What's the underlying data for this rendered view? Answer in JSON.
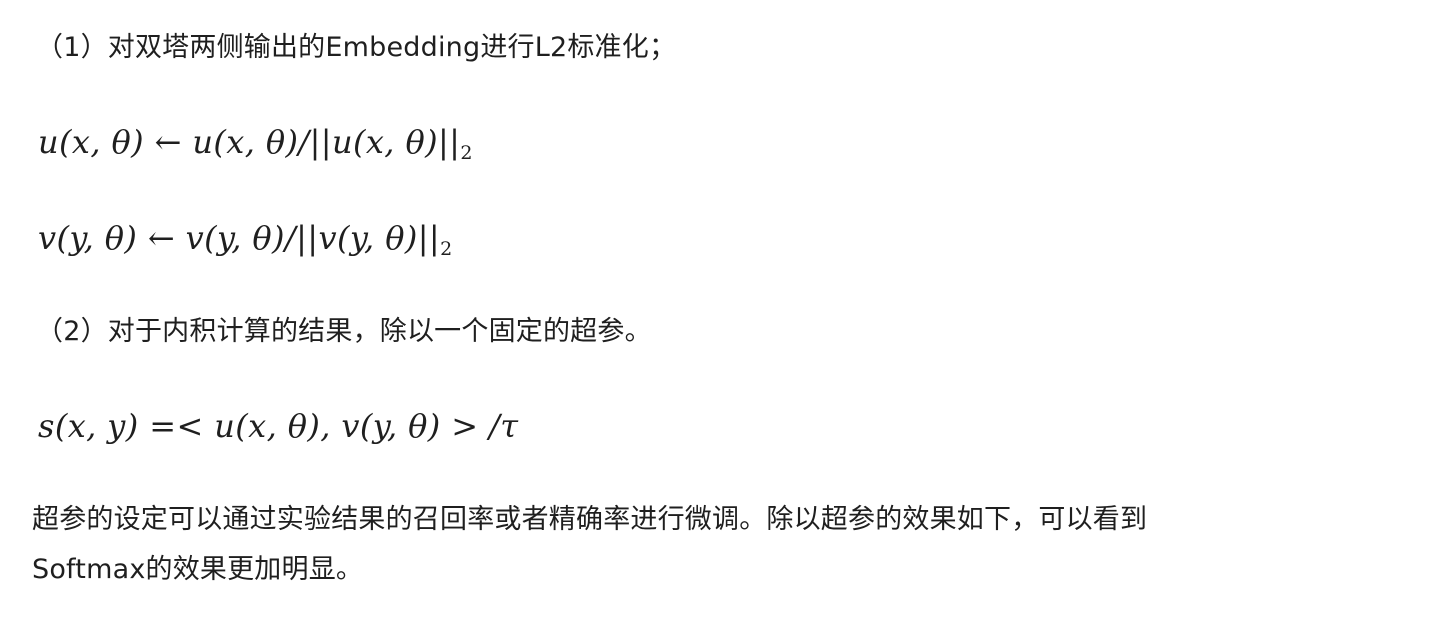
{
  "content": {
    "step1": "（1）对双塔两侧输出的Embedding进行L2标准化；",
    "step2": "（2）对于内积计算的结果，除以一个固定的超参。",
    "para_line1": "超参的设定可以通过实验结果的召回率或者精确率进行微调。除以超参的效果如下，可以看到",
    "para_line2": "Softmax的效果更加明显。"
  },
  "formulas": {
    "eq1": {
      "lhs": "u(x, θ) ← u(x, θ)/||u(x, θ)||",
      "sub": "2"
    },
    "eq2": {
      "lhs": "v(y, θ) ← v(y, θ)/||v(y, θ)||",
      "sub": "2"
    },
    "eq3": {
      "text": "s(x, y) =< u(x, θ), v(y, θ) > /τ"
    }
  }
}
